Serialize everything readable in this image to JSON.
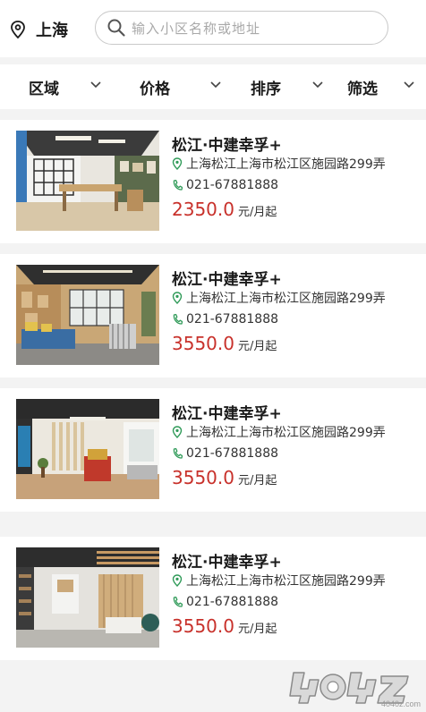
{
  "header": {
    "city": "上海",
    "search_placeholder": "输入小区名称或地址"
  },
  "filters": [
    {
      "label": "区域"
    },
    {
      "label": "价格"
    },
    {
      "label": "排序"
    },
    {
      "label": "筛选"
    }
  ],
  "listings": [
    {
      "title": "松江·中建幸孚+",
      "address": "上海松江上海市松江区施园路299弄",
      "phone": "021-67881888",
      "price": "2350.0",
      "unit": "元/月起"
    },
    {
      "title": "松江·中建幸孚+",
      "address": "上海松江上海市松江区施园路299弄",
      "phone": "021-67881888",
      "price": "3550.0",
      "unit": "元/月起"
    },
    {
      "title": "松江·中建幸孚+",
      "address": "上海松江上海市松江区施园路299弄",
      "phone": "021-67881888",
      "price": "3550.0",
      "unit": "元/月起"
    },
    {
      "title": "松江·中建幸孚+",
      "address": "上海松江上海市松江区施园路299弄",
      "phone": "021-67881888",
      "price": "3550.0",
      "unit": "元/月起"
    }
  ],
  "colors": {
    "price": "#c8312b",
    "location_icon": "#2f9a58",
    "page_gap": "#f3f3f3"
  },
  "icons": [
    "location-pin-icon",
    "search-icon",
    "chevron-down-icon",
    "address-pin-icon",
    "phone-icon"
  ],
  "watermark": {
    "text": "4040z.com"
  }
}
